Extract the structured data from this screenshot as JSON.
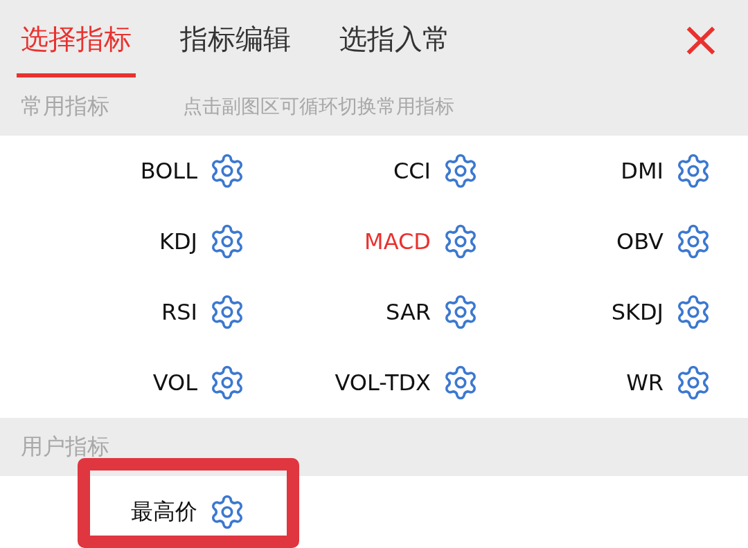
{
  "tabs": [
    {
      "label": "选择指标",
      "selected": true
    },
    {
      "label": "指标编辑",
      "selected": false
    },
    {
      "label": "选指入常",
      "selected": false
    }
  ],
  "close": {
    "label": "×"
  },
  "common_section": {
    "title": "常用指标",
    "hint": "点击副图区可循环切换常用指标"
  },
  "common_indicators": [
    {
      "name": "BOLL",
      "selected": false
    },
    {
      "name": "CCI",
      "selected": false
    },
    {
      "name": "DMI",
      "selected": false
    },
    {
      "name": "KDJ",
      "selected": false
    },
    {
      "name": "MACD",
      "selected": true
    },
    {
      "name": "OBV",
      "selected": false
    },
    {
      "name": "RSI",
      "selected": false
    },
    {
      "name": "SAR",
      "selected": false
    },
    {
      "name": "SKDJ",
      "selected": false
    },
    {
      "name": "VOL",
      "selected": false
    },
    {
      "name": "VOL-TDX",
      "selected": false
    },
    {
      "name": "WR",
      "selected": false
    }
  ],
  "user_section": {
    "title": "用户指标"
  },
  "user_indicators": [
    {
      "name": "最高价",
      "selected": false,
      "highlighted": true
    }
  ]
}
